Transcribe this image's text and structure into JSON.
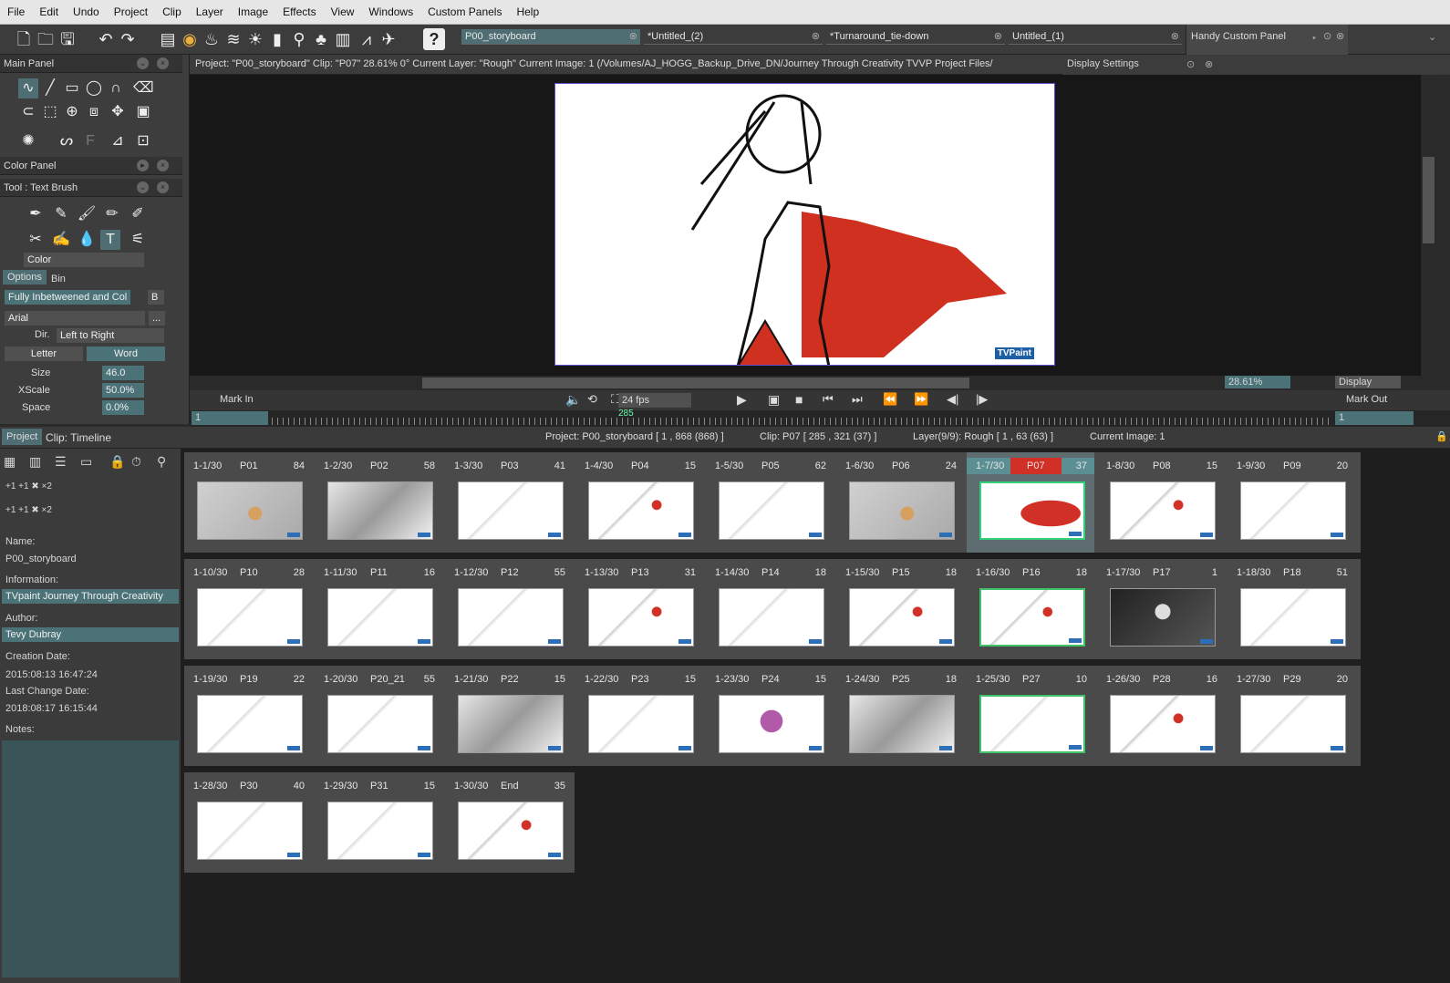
{
  "menu": [
    "File",
    "Edit",
    "Undo",
    "Project",
    "Clip",
    "Layer",
    "Image",
    "Effects",
    "View",
    "Windows",
    "Custom Panels",
    "Help"
  ],
  "tabs": [
    {
      "label": "P00_storyboard"
    },
    {
      "label": "*Untitled_(2)"
    },
    {
      "label": "*Turnaround_tie-down"
    },
    {
      "label": "Untitled_(1)"
    }
  ],
  "handy_panel": "Handy Custom Panel",
  "main_panel": "Main Panel",
  "color_panel": "Color Panel",
  "tool_panel": "Tool : Text Brush",
  "color_select": "Color",
  "options_tab": "Options",
  "bin_tab": "Bin",
  "mode_select": "Fully Inbetweened and Col",
  "b_button": "B",
  "font_select": "Arial",
  "more_button": "...",
  "dir_label": "Dir.",
  "dir_value": "Left to Right",
  "letter_button": "Letter",
  "word_button": "Word",
  "size_label": "Size",
  "size_value": "46.0",
  "xscale_label": "XScale",
  "xscale_value": "50.0%",
  "space_label": "Space",
  "space_value": "0.0%",
  "viewer_info": "Project: \"P00_storyboard\" Clip: \"P07\"  28.61%  0°  Current Layer: \"Rough\"  Current Image: 1 (/Volumes/AJ_HOGG_Backup_Drive_DN/Journey Through Creativity TVVP Project Files/",
  "display_settings": "Display Settings",
  "zoom": "28.61%",
  "display_btn": "Display",
  "mark_in": "Mark In",
  "mark_out": "Mark Out",
  "fps": "24 fps",
  "mark_in_value": "1",
  "mark_out_value": "1",
  "ruler_marker": "285",
  "watermark": "TVPaint",
  "project_tab": "Project",
  "timeline_tab": "Clip: Timeline",
  "info": {
    "project": "Project: P00_storyboard [ 1 , 868  (868) ]",
    "clip": "Clip: P07 [ 285 , 321  (37) ]",
    "layer": "Layer(9/9): Rough [ 1 , 63  (63) ]",
    "image": "Current Image: 1"
  },
  "props": {
    "name_label": "Name:",
    "name": "P00_storyboard",
    "info_label": "Information:",
    "info": "TVpaint Journey Through Creativity",
    "author_label": "Author:",
    "author": "Tevy Dubray",
    "created_label": "Creation Date:",
    "created": "2015:08:13 16:47:24",
    "changed_label": "Last Change Date:",
    "changed": "2018:08:17 16:15:44",
    "notes_label": "Notes:"
  },
  "clips": [
    {
      "idx": "1-1/30",
      "name": "P01",
      "frames": "84",
      "theme": "color-grey"
    },
    {
      "idx": "1-2/30",
      "name": "P02",
      "frames": "58",
      "theme": "grey"
    },
    {
      "idx": "1-3/30",
      "name": "P03",
      "frames": "41",
      "theme": "sketch"
    },
    {
      "idx": "1-4/30",
      "name": "P04",
      "frames": "15",
      "theme": "sketch-red"
    },
    {
      "idx": "1-5/30",
      "name": "P05",
      "frames": "62",
      "theme": "sketch"
    },
    {
      "idx": "1-6/30",
      "name": "P06",
      "frames": "24",
      "theme": "color-grey"
    },
    {
      "idx": "1-7/30",
      "name": "P07",
      "frames": "37",
      "theme": "red",
      "selected": true
    },
    {
      "idx": "1-8/30",
      "name": "P08",
      "frames": "15",
      "theme": "sketch-red"
    },
    {
      "idx": "1-9/30",
      "name": "P09",
      "frames": "20",
      "theme": "sketch"
    },
    {
      "idx": "1-10/30",
      "name": "P10",
      "frames": "28",
      "theme": "sketch"
    },
    {
      "idx": "1-11/30",
      "name": "P11",
      "frames": "16",
      "theme": "sketch"
    },
    {
      "idx": "1-12/30",
      "name": "P12",
      "frames": "55",
      "theme": "sketch"
    },
    {
      "idx": "1-13/30",
      "name": "P13",
      "frames": "31",
      "theme": "sketch-red"
    },
    {
      "idx": "1-14/30",
      "name": "P14",
      "frames": "18",
      "theme": "sketch"
    },
    {
      "idx": "1-15/30",
      "name": "P15",
      "frames": "18",
      "theme": "sketch-red"
    },
    {
      "idx": "1-16/30",
      "name": "P16",
      "frames": "18",
      "theme": "sketch-red",
      "green": true
    },
    {
      "idx": "1-17/30",
      "name": "P17",
      "frames": "1",
      "theme": "dark"
    },
    {
      "idx": "1-18/30",
      "name": "P18",
      "frames": "51",
      "theme": "sketch"
    },
    {
      "idx": "1-19/30",
      "name": "P19",
      "frames": "22",
      "theme": "sketch"
    },
    {
      "idx": "1-20/30",
      "name": "P20_21",
      "frames": "55",
      "theme": "sketch"
    },
    {
      "idx": "1-21/30",
      "name": "P22",
      "frames": "15",
      "theme": "grey"
    },
    {
      "idx": "1-22/30",
      "name": "P23",
      "frames": "15",
      "theme": "sketch"
    },
    {
      "idx": "1-23/30",
      "name": "P24",
      "frames": "15",
      "theme": "sketch-purple"
    },
    {
      "idx": "1-24/30",
      "name": "P25",
      "frames": "18",
      "theme": "grey"
    },
    {
      "idx": "1-25/30",
      "name": "P27",
      "frames": "10",
      "theme": "sketch",
      "green": true
    },
    {
      "idx": "1-26/30",
      "name": "P28",
      "frames": "16",
      "theme": "sketch-red"
    },
    {
      "idx": "1-27/30",
      "name": "P29",
      "frames": "20",
      "theme": "sketch"
    },
    {
      "idx": "1-28/30",
      "name": "P30",
      "frames": "40",
      "theme": "sketch"
    },
    {
      "idx": "1-29/30",
      "name": "P31",
      "frames": "15",
      "theme": "sketch"
    },
    {
      "idx": "1-30/30",
      "name": "End",
      "frames": "35",
      "theme": "sketch-red"
    }
  ],
  "colors": {
    "accent": "#4f6e73",
    "selection": "#33d07a",
    "brand_red": "#d03025"
  }
}
